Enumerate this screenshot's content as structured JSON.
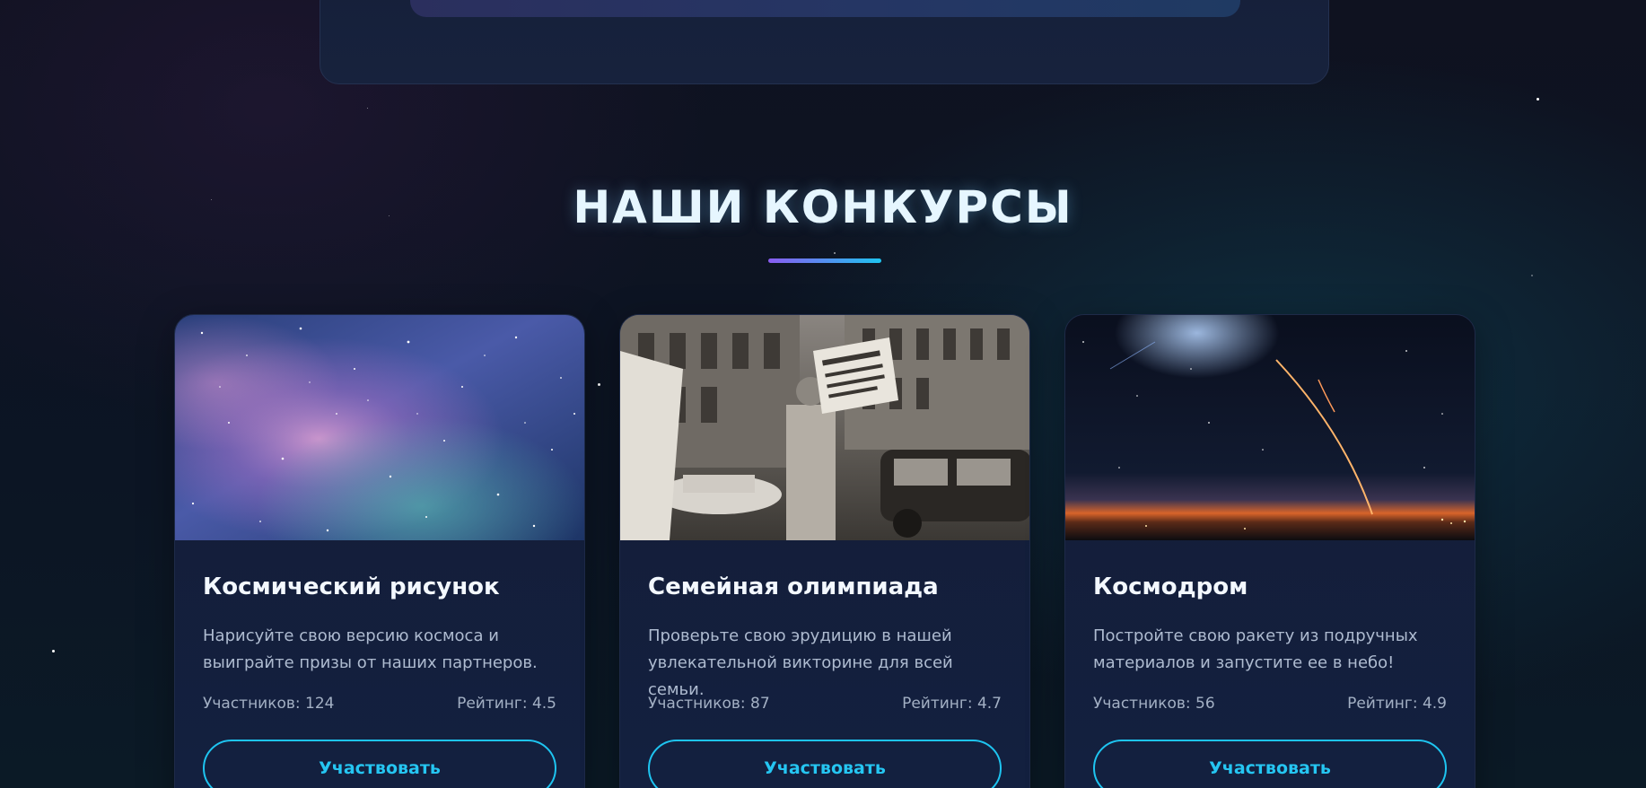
{
  "section": {
    "title": "НАШИ КОНКУРСЫ"
  },
  "colors": {
    "accent": "#1ec4f0",
    "accent_purple": "#8a5cf0",
    "card_bg": "#141d36",
    "page_bg": "#0b0f1c"
  },
  "cards": [
    {
      "image": "milky-way-galaxy-image",
      "title": "Космический рисунок",
      "description": "Нарисуйте свою версию космоса и выиграйте призы от наших партнеров.",
      "participants": "Участников: 124",
      "rating": "Рейтинг: 4.5",
      "button": "Участвовать"
    },
    {
      "image": "vintage-newspaper-street-image",
      "title": "Семейная олимпиада",
      "description": "Проверьте свою эрудицию в нашей увлекательной викторине для всей семьи.",
      "participants": "Участников: 87",
      "rating": "Рейтинг: 4.7",
      "button": "Участвовать"
    },
    {
      "image": "rocket-launch-night-image",
      "title": "Космодром",
      "description": "Постройте свою ракету из подручных материалов и запустите ее в небо!",
      "participants": "Участников: 56",
      "rating": "Рейтинг: 4.9",
      "button": "Участвовать"
    }
  ]
}
